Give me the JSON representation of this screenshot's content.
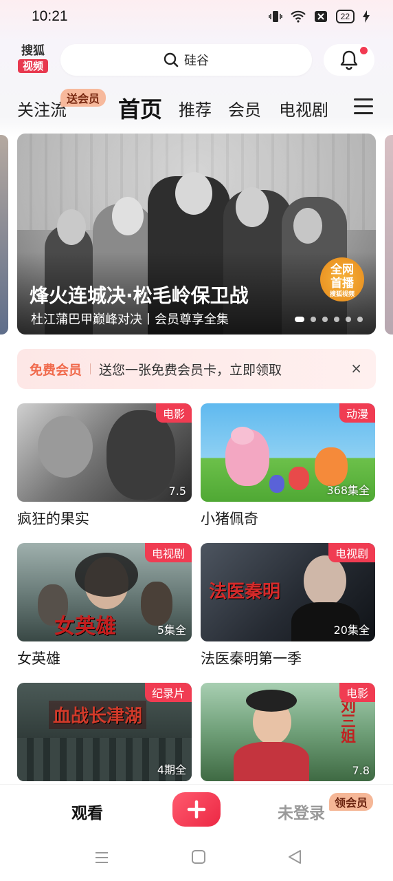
{
  "status_bar": {
    "time": "10:21",
    "battery": "22"
  },
  "header": {
    "logo_top": "搜狐",
    "logo_bottom": "视频",
    "search_text": "硅谷"
  },
  "tabs": {
    "items": [
      "关注流",
      "首页",
      "推荐",
      "会员",
      "电视剧"
    ],
    "active": "首页",
    "follow_badge": "送会员"
  },
  "banner": {
    "title": "烽火连城决·松毛岭保卫战",
    "subtitle": "杜江蒲巴甲巅峰对决丨会员尊享全集",
    "live_badge_line1": "全网",
    "live_badge_line2": "首播",
    "live_badge_small": "搜狐视频",
    "dot_count": 6,
    "active_dot": 1
  },
  "promo": {
    "tag": "免费会员",
    "text": "送您一张免费会员卡，立即领取",
    "close": "×"
  },
  "cards": [
    {
      "title": "疯狂的果实",
      "tag": "电影",
      "corner": "7.5",
      "overlay": ""
    },
    {
      "title": "小猪佩奇",
      "tag": "动漫",
      "corner": "368集全",
      "overlay": ""
    },
    {
      "title": "女英雄",
      "tag": "电视剧",
      "corner": "5集全",
      "overlay": "女英雄"
    },
    {
      "title": "法医秦明第一季",
      "tag": "电视剧",
      "corner": "20集全",
      "overlay": "法医秦明"
    },
    {
      "title": "",
      "tag": "纪录片",
      "corner": "4期全",
      "overlay": "血战长津湖"
    },
    {
      "title": "",
      "tag": "电影",
      "corner": "7.8",
      "overlay": "刘三姐"
    }
  ],
  "bottom_nav": {
    "watch": "观看",
    "login": "未登录",
    "login_badge": "领会员"
  },
  "colors": {
    "accent": "#f03c52",
    "badge": "#f7b99c"
  }
}
